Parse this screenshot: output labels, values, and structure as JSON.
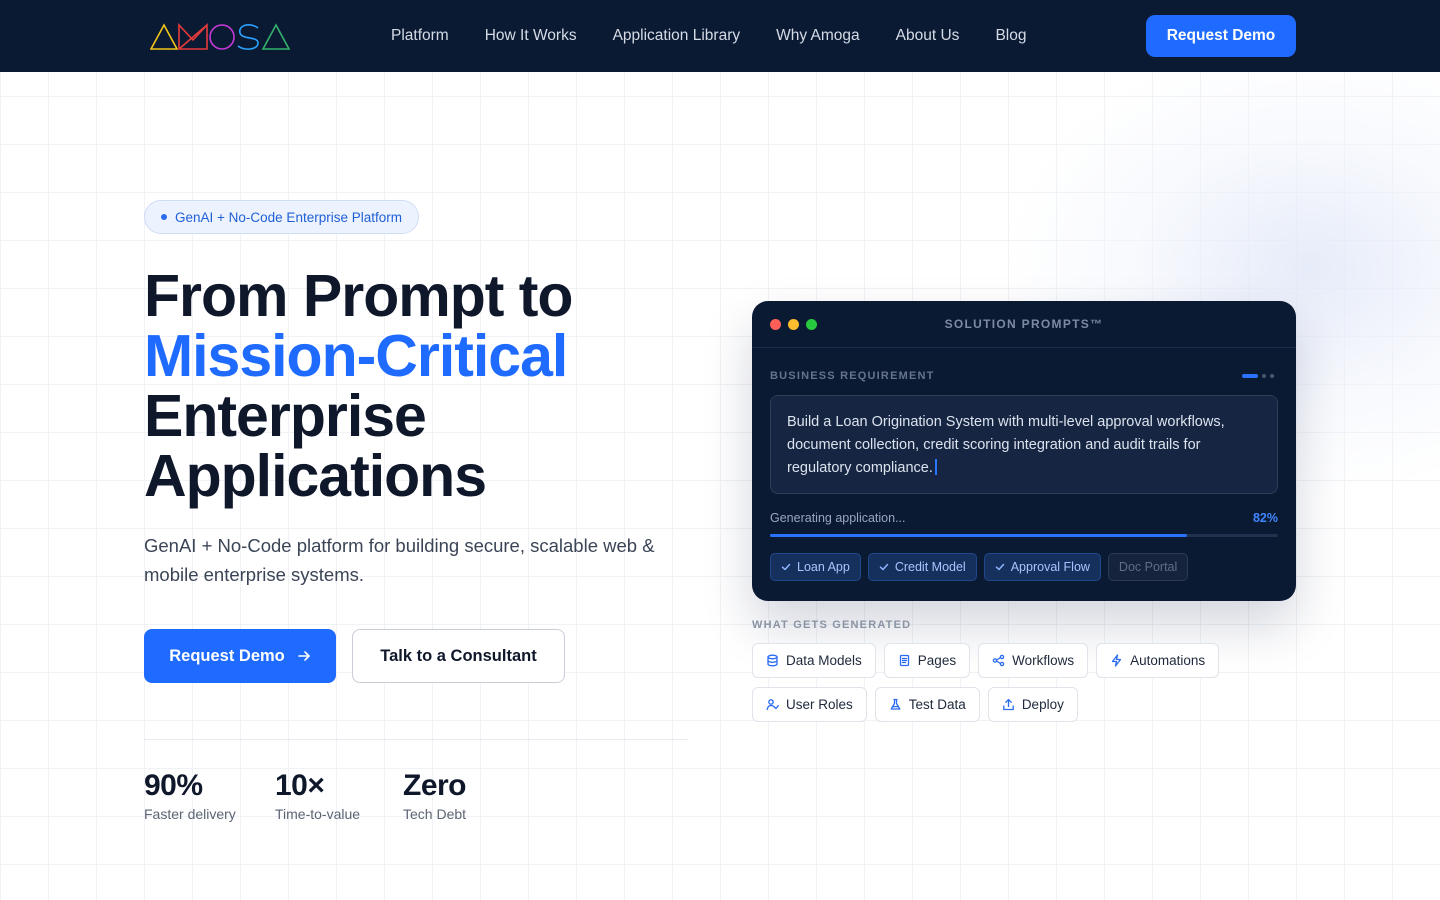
{
  "nav": {
    "logo_text": "AMOGA",
    "links": [
      "Platform",
      "How It Works",
      "Application Library",
      "Why Amoga",
      "About Us",
      "Blog"
    ],
    "cta": "Request Demo"
  },
  "hero": {
    "badge": "GenAI + No-Code Enterprise Platform",
    "headline_1": "From Prompt to",
    "headline_accent": "Mission-Critical",
    "headline_2": "Enterprise",
    "headline_3": "Applications",
    "subhead": "GenAI + No-Code platform for building secure, scalable web & mobile enterprise systems.",
    "primary_cta": "Request Demo",
    "secondary_cta": "Talk to a Consultant"
  },
  "stats": [
    {
      "value": "90%",
      "label": "Faster delivery"
    },
    {
      "value": "10×",
      "label": "Time-to-value"
    },
    {
      "value": "Zero",
      "label": "Tech Debt"
    }
  ],
  "card": {
    "title": "SOLUTION PROMPTS™",
    "requirement_label": "BUSINESS REQUIREMENT",
    "prompt": "Build a Loan Origination System with multi-level approval workflows, document collection, credit scoring integration and audit trails for regulatory compliance.",
    "status_label": "Generating application...",
    "progress_text": "82%",
    "progress": 0.82,
    "chips": [
      {
        "label": "Loan App",
        "done": true
      },
      {
        "label": "Credit Model",
        "done": true
      },
      {
        "label": "Approval Flow",
        "done": true
      },
      {
        "label": "Doc Portal",
        "done": false
      }
    ]
  },
  "generated": {
    "heading": "WHAT GETS GENERATED",
    "items": [
      {
        "label": "Data Models",
        "icon": "database-icon"
      },
      {
        "label": "Pages",
        "icon": "document-icon"
      },
      {
        "label": "Workflows",
        "icon": "workflow-icon"
      },
      {
        "label": "Automations",
        "icon": "lightning-icon"
      },
      {
        "label": "User Roles",
        "icon": "user-check-icon"
      },
      {
        "label": "Test Data",
        "icon": "flask-icon"
      },
      {
        "label": "Deploy",
        "icon": "upload-icon"
      }
    ]
  },
  "colors": {
    "nav_bg": "#0b1a33",
    "accent": "#1f6bff",
    "card_bg": "#0b1a33",
    "dot_red": "#ff5f57",
    "dot_yellow": "#febc2e",
    "dot_green": "#28c840"
  }
}
